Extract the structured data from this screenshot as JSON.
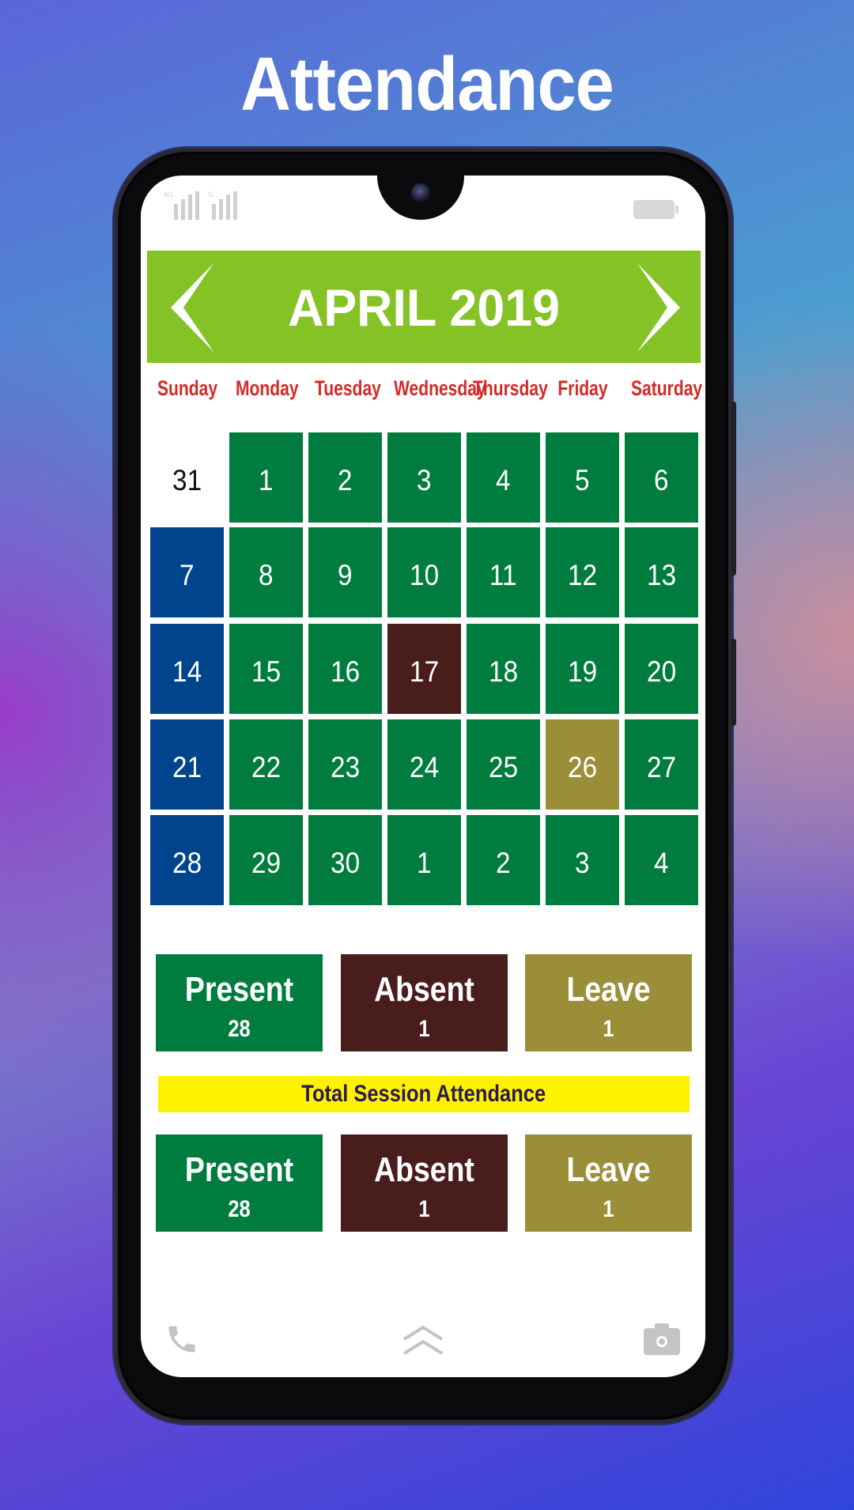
{
  "page_title": "Attendance",
  "status_bar": {
    "network_1": "4G",
    "network_2": "G"
  },
  "calendar": {
    "month_label": "APRIL 2019",
    "prev_icon": "chevron-left-icon",
    "next_icon": "chevron-right-icon",
    "weekdays": [
      "Sunday",
      "Monday",
      "Tuesday",
      "Wednesday",
      "Thursday",
      "Friday",
      "Saturday"
    ],
    "weeks": [
      [
        {
          "day": "31",
          "status": "outside"
        },
        {
          "day": "1",
          "status": "present"
        },
        {
          "day": "2",
          "status": "present"
        },
        {
          "day": "3",
          "status": "present"
        },
        {
          "day": "4",
          "status": "present"
        },
        {
          "day": "5",
          "status": "present"
        },
        {
          "day": "6",
          "status": "present"
        }
      ],
      [
        {
          "day": "7",
          "status": "holiday"
        },
        {
          "day": "8",
          "status": "present"
        },
        {
          "day": "9",
          "status": "present"
        },
        {
          "day": "10",
          "status": "present"
        },
        {
          "day": "11",
          "status": "present"
        },
        {
          "day": "12",
          "status": "present"
        },
        {
          "day": "13",
          "status": "present"
        }
      ],
      [
        {
          "day": "14",
          "status": "holiday"
        },
        {
          "day": "15",
          "status": "present"
        },
        {
          "day": "16",
          "status": "present"
        },
        {
          "day": "17",
          "status": "absent"
        },
        {
          "day": "18",
          "status": "present"
        },
        {
          "day": "19",
          "status": "present"
        },
        {
          "day": "20",
          "status": "present"
        }
      ],
      [
        {
          "day": "21",
          "status": "holiday"
        },
        {
          "day": "22",
          "status": "present"
        },
        {
          "day": "23",
          "status": "present"
        },
        {
          "day": "24",
          "status": "present"
        },
        {
          "day": "25",
          "status": "present"
        },
        {
          "day": "26",
          "status": "leave"
        },
        {
          "day": "27",
          "status": "present"
        }
      ],
      [
        {
          "day": "28",
          "status": "holiday"
        },
        {
          "day": "29",
          "status": "present"
        },
        {
          "day": "30",
          "status": "present"
        },
        {
          "day": "1",
          "status": "present"
        },
        {
          "day": "2",
          "status": "present"
        },
        {
          "day": "3",
          "status": "present"
        },
        {
          "day": "4",
          "status": "present"
        }
      ]
    ]
  },
  "monthly_summary": {
    "present": {
      "label": "Present",
      "value": "28"
    },
    "absent": {
      "label": "Absent",
      "value": "1"
    },
    "leave": {
      "label": "Leave",
      "value": "1"
    }
  },
  "session_title": "Total Session Attendance",
  "session_summary": {
    "present": {
      "label": "Present",
      "value": "28"
    },
    "absent": {
      "label": "Absent",
      "value": "1"
    },
    "leave": {
      "label": "Leave",
      "value": "1"
    }
  },
  "bottom_nav": {
    "left": "phone-icon",
    "center": "swipe-up-icon",
    "right": "camera-icon"
  },
  "colors": {
    "header_green": "#84c226",
    "present": "#007d3e",
    "absent": "#4a1d1d",
    "leave": "#9a8e39",
    "holiday": "#00448d",
    "weekday_label": "#d42a27",
    "session_bar": "#fff200",
    "session_text": "#2a1a55"
  }
}
